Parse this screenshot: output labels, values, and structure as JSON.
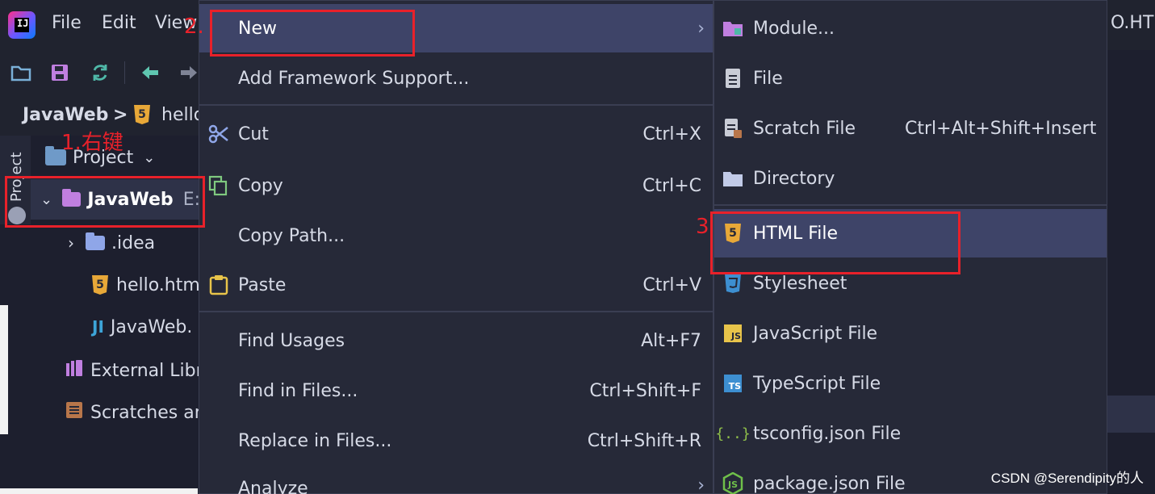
{
  "menubar": {
    "logo_text": "IJ",
    "items": [
      {
        "label": "File"
      },
      {
        "label": "Edit"
      },
      {
        "label": "View"
      }
    ]
  },
  "breadcrumb": {
    "project": "JavaWeb",
    "separator": ">",
    "file": "hello"
  },
  "side_panel": {
    "label": "Project"
  },
  "project_tool": {
    "header": "Project",
    "tree": [
      {
        "label": "JavaWeb",
        "suffix": "E:"
      },
      {
        "label": ".idea"
      },
      {
        "label": "hello.htm"
      },
      {
        "label": "JavaWeb."
      },
      {
        "label": "External Libr"
      },
      {
        "label": "Scratches ar"
      }
    ]
  },
  "editor": {
    "tab_fragment": "O.HT"
  },
  "context_menu": {
    "items": [
      {
        "label": "New",
        "shortcut": "",
        "arrow": "›"
      },
      {
        "label": "Add Framework Support...",
        "shortcut": ""
      },
      {
        "label": "Cut",
        "shortcut": "Ctrl+X"
      },
      {
        "label": "Copy",
        "shortcut": "Ctrl+C"
      },
      {
        "label": "Copy Path...",
        "shortcut": ""
      },
      {
        "label": "Paste",
        "shortcut": "Ctrl+V"
      },
      {
        "label": "Find Usages",
        "shortcut": "Alt+F7"
      },
      {
        "label": "Find in Files...",
        "shortcut": "Ctrl+Shift+F"
      },
      {
        "label": "Replace in Files...",
        "shortcut": "Ctrl+Shift+R"
      },
      {
        "label": "Analyze",
        "shortcut": "",
        "arrow": "›"
      }
    ]
  },
  "new_submenu": {
    "items": [
      {
        "label": "Module...",
        "shortcut": ""
      },
      {
        "label": "File",
        "shortcut": ""
      },
      {
        "label": "Scratch File",
        "shortcut": "Ctrl+Alt+Shift+Insert"
      },
      {
        "label": "Directory",
        "shortcut": ""
      },
      {
        "label": "HTML File",
        "shortcut": ""
      },
      {
        "label": "Stylesheet",
        "shortcut": ""
      },
      {
        "label": "JavaScript File",
        "shortcut": ""
      },
      {
        "label": "TypeScript File",
        "shortcut": ""
      },
      {
        "label": "tsconfig.json File",
        "shortcut": ""
      },
      {
        "label": "package.json File",
        "shortcut": ""
      }
    ]
  },
  "annotations": {
    "step1": "1.右键",
    "step2": "2.",
    "step3": "3"
  },
  "watermark": "CSDN @Serendipity的人",
  "colors": {
    "background": "#1d1f2e",
    "menu_bg": "#262938",
    "highlight": "#3e4468",
    "annotation_red": "#e8212a",
    "folder_purple": "#c07fe0",
    "folder_blue": "#8fa6e8",
    "html_orange": "#e8a838"
  }
}
